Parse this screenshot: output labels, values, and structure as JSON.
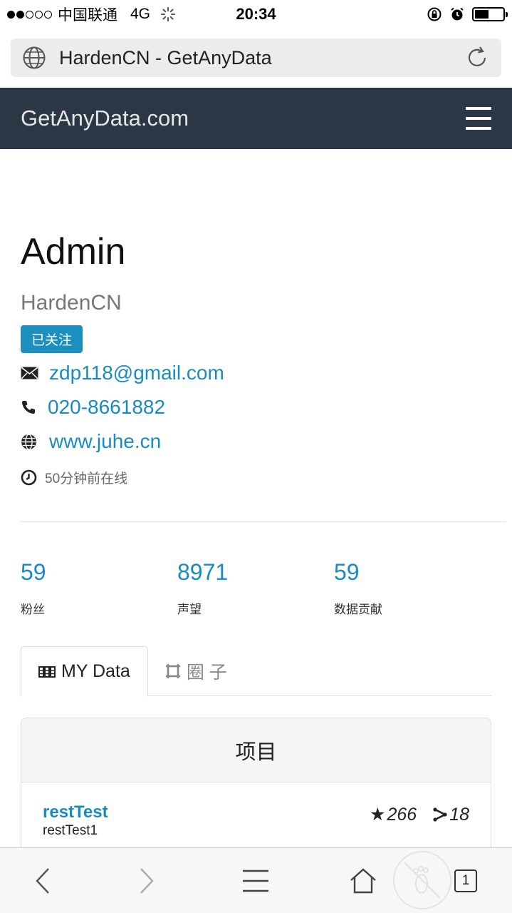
{
  "status_bar": {
    "carrier": "中国联通",
    "network": "4G",
    "time": "20:34",
    "battery_level": 0.5,
    "signal_bars": [
      true,
      true,
      false,
      false,
      false
    ]
  },
  "browser": {
    "page_title": "HardenCN - GetAnyData",
    "icons": {
      "site": "globe-icon",
      "reload": "reload-icon"
    }
  },
  "navbar": {
    "brand": "GetAnyData.com",
    "menu_icon": "hamburger-menu-icon",
    "bg_color": "#2b3744"
  },
  "profile": {
    "role": "Admin",
    "username": "HardenCN",
    "follow_badge": "已关注",
    "email": "zdp118@gmail.com",
    "phone": "020-8661882",
    "website": "www.juhe.cn",
    "last_seen": "50分钟前在线",
    "accent_color": "#1a8bc1"
  },
  "stats": [
    {
      "value": "59",
      "label": "粉丝"
    },
    {
      "value": "8971",
      "label": "声望"
    },
    {
      "value": "59",
      "label": "数据贡献"
    }
  ],
  "tabs": [
    {
      "label": "MY Data",
      "icon": "table-icon",
      "active": true
    },
    {
      "label": "圈 子",
      "icon": "crop-icon",
      "active": false
    }
  ],
  "projects": {
    "header": "项目",
    "items": [
      {
        "name": "restTest",
        "description": "restTest1",
        "stars": "266",
        "forks": "18"
      }
    ]
  },
  "toolbar": {
    "tab_count": "1"
  }
}
